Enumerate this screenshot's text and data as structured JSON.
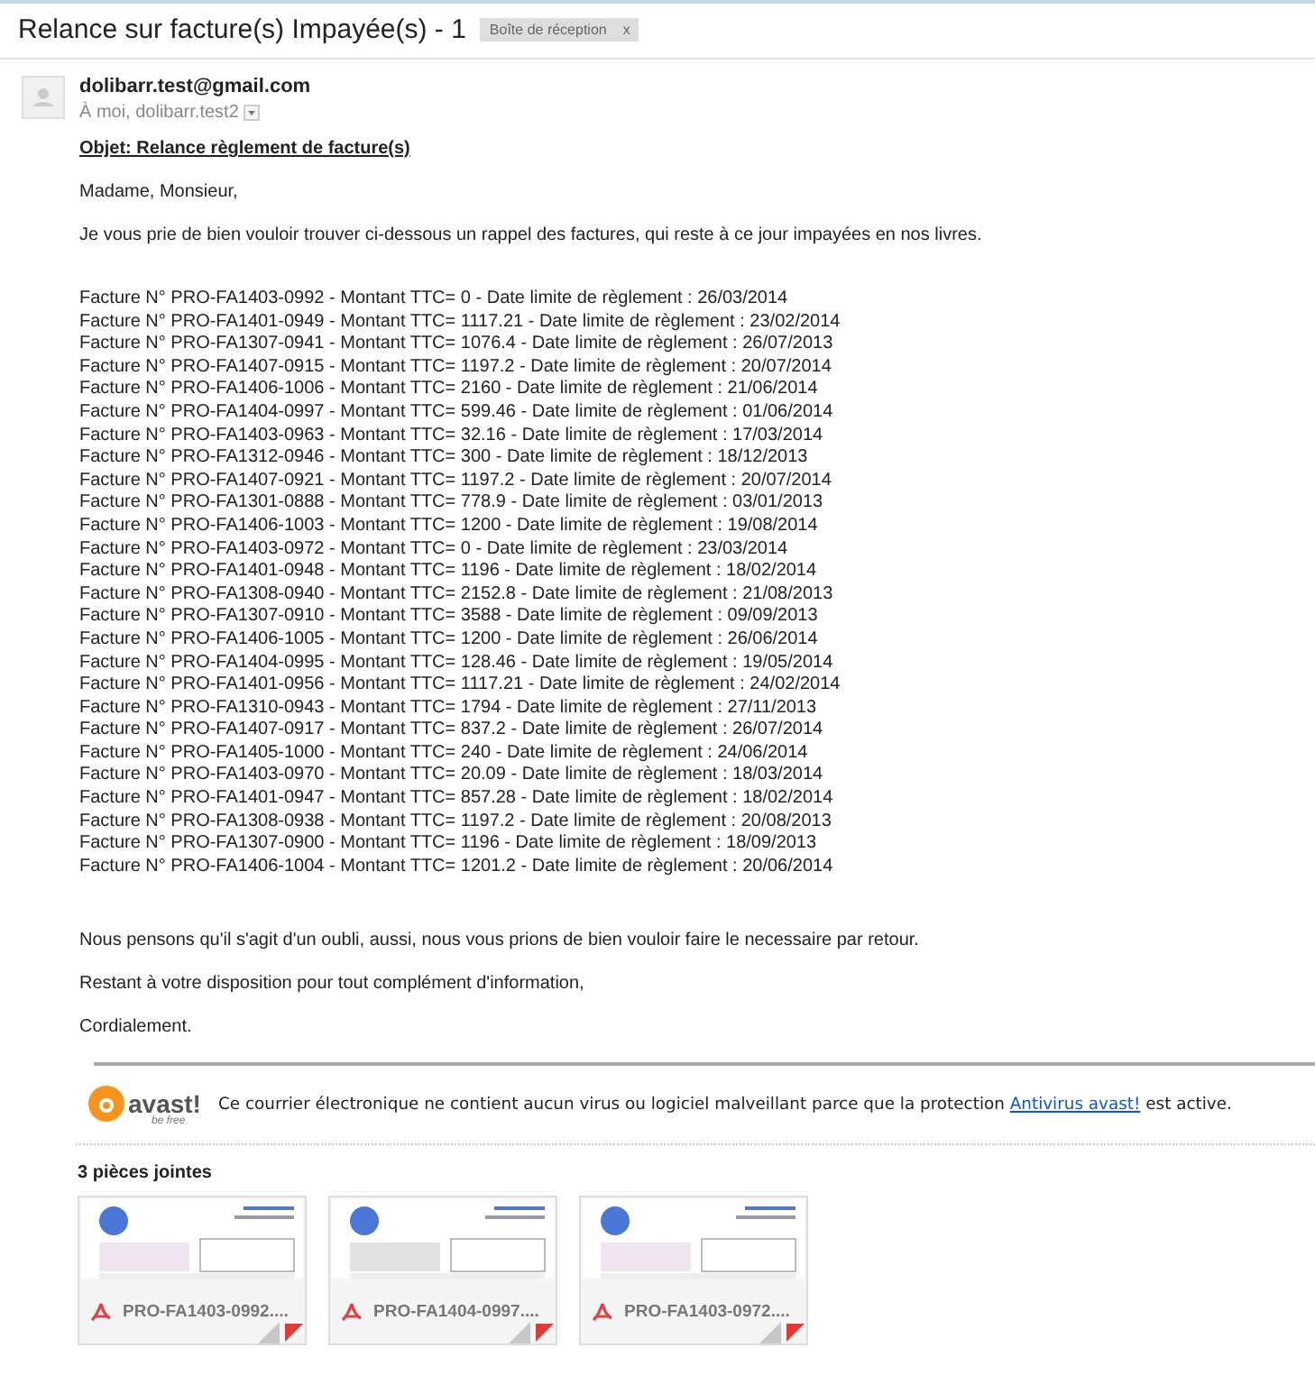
{
  "subject": "Relance sur facture(s) Impayée(s) - 1",
  "label": {
    "text": "Boîte de réception",
    "close": "x"
  },
  "sender": "dolibarr.test@gmail.com",
  "recipients": "À moi, dolibarr.test2",
  "body": {
    "objet": "Objet: Relance règlement de facture(s)",
    "greeting": "Madame, Monsieur,",
    "intro": "Je vous prie de bien vouloir trouver ci-dessous un rappel des factures, qui reste à ce jour impayées en nos livres.",
    "invoices": [
      "Facture N° PRO-FA1403-0992 - Montant TTC= 0 - Date limite de règlement : 26/03/2014",
      "Facture N° PRO-FA1401-0949 - Montant TTC= 1117.21 - Date limite de règlement : 23/02/2014",
      "Facture N° PRO-FA1307-0941 - Montant TTC= 1076.4 - Date limite de règlement : 26/07/2013",
      "Facture N° PRO-FA1407-0915 - Montant TTC= 1197.2 - Date limite de règlement : 20/07/2014",
      "Facture N° PRO-FA1406-1006 - Montant TTC= 2160 - Date limite de règlement : 21/06/2014",
      "Facture N° PRO-FA1404-0997 - Montant TTC= 599.46 - Date limite de règlement : 01/06/2014",
      "Facture N° PRO-FA1403-0963 - Montant TTC= 32.16 - Date limite de règlement : 17/03/2014",
      "Facture N° PRO-FA1312-0946 - Montant TTC= 300 - Date limite de règlement : 18/12/2013",
      "Facture N° PRO-FA1407-0921 - Montant TTC= 1197.2 - Date limite de règlement : 20/07/2014",
      "Facture N° PRO-FA1301-0888 - Montant TTC= 778.9 - Date limite de règlement : 03/01/2013",
      "Facture N° PRO-FA1406-1003 - Montant TTC= 1200 - Date limite de règlement : 19/08/2014",
      "Facture N° PRO-FA1403-0972 - Montant TTC= 0 - Date limite de règlement : 23/03/2014",
      "Facture N° PRO-FA1401-0948 - Montant TTC= 1196 - Date limite de règlement : 18/02/2014",
      "Facture N° PRO-FA1308-0940 - Montant TTC= 2152.8 - Date limite de règlement : 21/08/2013",
      "Facture N° PRO-FA1307-0910 - Montant TTC= 3588 - Date limite de règlement : 09/09/2013",
      "Facture N° PRO-FA1406-1005 - Montant TTC= 1200 - Date limite de règlement : 26/06/2014",
      "Facture N° PRO-FA1404-0995 - Montant TTC= 128.46 - Date limite de règlement : 19/05/2014",
      "Facture N° PRO-FA1401-0956 - Montant TTC= 1117.21 - Date limite de règlement : 24/02/2014",
      "Facture N° PRO-FA1310-0943 - Montant TTC= 1794 - Date limite de règlement : 27/11/2013",
      "Facture N° PRO-FA1407-0917 - Montant TTC= 837.2 - Date limite de règlement : 26/07/2014",
      "Facture N° PRO-FA1405-1000 - Montant TTC= 240 - Date limite de règlement : 24/06/2014",
      "Facture N° PRO-FA1403-0970 - Montant TTC= 20.09 - Date limite de règlement : 18/03/2014",
      "Facture N° PRO-FA1401-0947 - Montant TTC= 857.28 - Date limite de règlement : 18/02/2014",
      "Facture N° PRO-FA1308-0938 - Montant TTC= 1197.2 - Date limite de règlement : 20/08/2013",
      "Facture N° PRO-FA1307-0900 - Montant TTC= 1196 - Date limite de règlement : 18/09/2013",
      "Facture N° PRO-FA1406-1004 - Montant TTC= 1201.2 - Date limite de règlement : 20/06/2014"
    ],
    "closing": [
      "Nous pensons qu'il s'agit d'un oubli, aussi, nous vous prions de bien vouloir faire le necessaire par retour.",
      "Restant à votre disposition pour tout complément d'information,",
      "Cordialement."
    ]
  },
  "signature": {
    "logo": "avast!",
    "tagline": "be free",
    "before": "Ce courrier électronique ne contient aucun virus ou logiciel malveillant parce que la protection",
    "link": "Antivirus avast!",
    "after": "est active."
  },
  "attachments": {
    "title": "3 pièces jointes",
    "items": [
      {
        "name": "PRO-FA1403-0992....",
        "kind": "picture"
      },
      {
        "name": "PRO-FA1404-0997....",
        "kind": "picture"
      },
      {
        "name": "PRO-FA1403-0972....",
        "kind": "picture"
      }
    ]
  }
}
